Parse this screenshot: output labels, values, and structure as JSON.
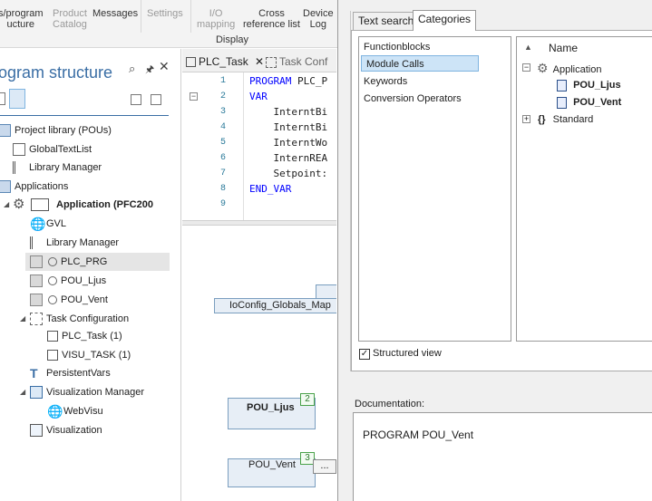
{
  "ribbon": {
    "program_structure_line1": "s/program",
    "program_structure_line2": "ucture",
    "product_catalog_line1": "Product",
    "product_catalog_line2": "Catalog",
    "messages": "Messages",
    "settings": "Settings",
    "io_mapping_line1": "I/O",
    "io_mapping_line2": "mapping",
    "cross_ref_line1": "Cross",
    "cross_ref_line2": "reference list",
    "device_log_line1": "Device",
    "device_log_line2": "Log",
    "group_label": "Display"
  },
  "left_panel": {
    "title": "ogram structure",
    "tree": [
      {
        "label": "Project library (POUs)",
        "icon": "library-icon"
      },
      {
        "label": "GlobalTextList",
        "icon": "textlist-icon"
      },
      {
        "label": "Library Manager",
        "icon": "library-manager-icon"
      },
      {
        "label": "Applications",
        "icon": "applications-icon"
      },
      {
        "label": "Application (PFC200",
        "icon": "gear-icon"
      },
      {
        "label": "GVL",
        "icon": "globe-icon"
      },
      {
        "label": "Library Manager",
        "icon": "library-manager-icon"
      },
      {
        "label": "PLC_PRG",
        "icon": "cfc-icon"
      },
      {
        "label": "POU_Ljus",
        "icon": "cfc-icon"
      },
      {
        "label": "POU_Vent",
        "icon": "cfc-icon"
      },
      {
        "label": "Task Configuration",
        "icon": "task-config-icon"
      },
      {
        "label": "PLC_Task (1)",
        "icon": "task-icon"
      },
      {
        "label": "VISU_TASK (1)",
        "icon": "task-icon"
      },
      {
        "label": "PersistentVars",
        "icon": "persistent-icon"
      },
      {
        "label": "Visualization Manager",
        "icon": "visu-manager-icon"
      },
      {
        "label": "WebVisu",
        "icon": "globe-icon"
      },
      {
        "label": "Visualization",
        "icon": "visualization-icon"
      }
    ]
  },
  "editor": {
    "tabs": [
      {
        "label": "PLC_Task"
      },
      {
        "label": "Task Conf"
      }
    ],
    "lines": [
      {
        "no": "1",
        "text_kw": "PROGRAM",
        "text": " PLC_P"
      },
      {
        "no": "2",
        "text_kw": "VAR",
        "text": ""
      },
      {
        "no": "3",
        "text_kw": "",
        "text": "    InterntBi"
      },
      {
        "no": "4",
        "text_kw": "",
        "text": "    InterntBi"
      },
      {
        "no": "5",
        "text_kw": "",
        "text": "    InterntWo"
      },
      {
        "no": "6",
        "text_kw": "",
        "text": "    InternREA"
      },
      {
        "no": "7",
        "text_kw": "",
        "text": "    Setpoint:"
      },
      {
        "no": "8",
        "text_kw": "END_VAR",
        "text": ""
      },
      {
        "no": "9",
        "text_kw": "",
        "text": ""
      }
    ],
    "cfc": {
      "ioconfig_label": "IoConfig_Globals_Map",
      "pou_ljus_label": "POU_Ljus",
      "pou_ljus_order": "2",
      "pou_vent_label": "POU_Vent",
      "pou_vent_order": "3",
      "ellipsis": "..."
    }
  },
  "dialog": {
    "tabs": [
      {
        "label": "Text search"
      },
      {
        "label": "Categories"
      }
    ],
    "categories": [
      {
        "label": "Functionblocks"
      },
      {
        "label": "Module Calls"
      },
      {
        "label": "Keywords"
      },
      {
        "label": "Conversion Operators"
      }
    ],
    "tree_header": "Name",
    "tree": [
      {
        "label": "Application"
      },
      {
        "label": "POU_Ljus"
      },
      {
        "label": "POU_Vent"
      },
      {
        "label": "Standard"
      }
    ],
    "structured_view_label": "Structured view",
    "structured_view_checked": true,
    "documentation_label": "Documentation:",
    "documentation_text": "PROGRAM POU_Vent"
  },
  "colors": {
    "accent_title": "#3a6ea5",
    "selection": "#cde4f7",
    "keyword": "#0000ff"
  }
}
